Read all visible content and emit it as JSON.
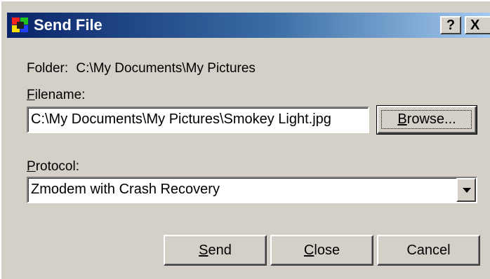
{
  "window": {
    "title": "Send File",
    "help_glyph": "?",
    "close_glyph": "X",
    "app_icon": "app-icon"
  },
  "folder": {
    "label": "Folder:",
    "path": "C:\\My Documents\\My Pictures"
  },
  "filename": {
    "label_accel": "F",
    "label_rest": "ilename:",
    "value": "C:\\My Documents\\My Pictures\\Smokey Light.jpg",
    "browse_accel": "B",
    "browse_rest": "rowse..."
  },
  "protocol": {
    "label_accel": "P",
    "label_rest": "rotocol:",
    "selected": "Zmodem with Crash Recovery"
  },
  "actions": {
    "send_accel": "S",
    "send_rest": "end",
    "close_accel": "C",
    "close_rest": "lose",
    "cancel": "Cancel"
  },
  "colors": {
    "face": "#d4d0c8",
    "title_start": "#0a246a",
    "title_end": "#a6caf0"
  }
}
